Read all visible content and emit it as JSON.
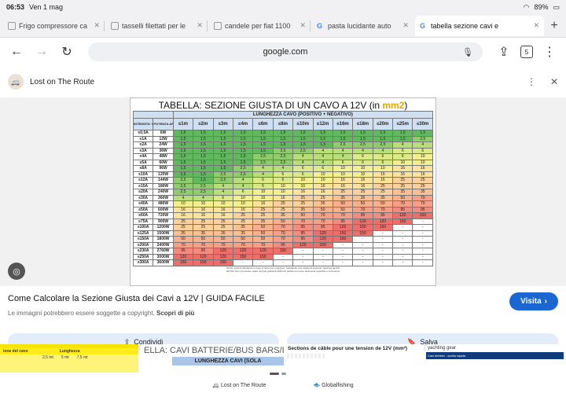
{
  "status": {
    "time": "06:53",
    "date": "Ven 1 mag",
    "battery": "89%"
  },
  "tabs": [
    {
      "title": "Frigo compressore cа"
    },
    {
      "title": "tasselli filettati per le"
    },
    {
      "title": "candele per fiat 1100"
    },
    {
      "title": "pasta lucidante auto"
    },
    {
      "title": "tabella sezione cavi e"
    }
  ],
  "toolbar": {
    "url": "google.com",
    "tab_count": "5"
  },
  "site": {
    "name": "Lost on The Route"
  },
  "table": {
    "title": "TABELLA: SEZIONE GIUSTA DI UN CAVO A 12V (in ",
    "title_unit": "mm2",
    "title_end": ")",
    "length_header": "LUNGHEZZA CAVO (POSITIVO + NEGATIVO)",
    "col1_header": "INTENSITA' CORRENTE",
    "col2_header": "POTENZA APPARATO",
    "lengths": [
      "≤1m",
      "≤2m",
      "≤3m",
      "≤4m",
      "≤6m",
      "≤8m",
      "≤10m",
      "≤12m",
      "≤16m",
      "≤18m",
      "≤20m",
      "≤25m",
      "≤30m"
    ],
    "rows": [
      [
        "≤0,5A",
        "6W",
        "1,5",
        "1,5",
        "1,5",
        "1,5",
        "1,5",
        "1,5",
        "1,5",
        "1,5",
        "1,5",
        "1,5",
        "1,5",
        "1,5",
        "1,5"
      ],
      [
        "≤1A",
        "12W",
        "1,5",
        "1,5",
        "1,5",
        "1,5",
        "1,5",
        "1,5",
        "1,5",
        "1,5",
        "1,5",
        "1,5",
        "1,5",
        "1,5",
        "2,5"
      ],
      [
        "≤2A",
        "24W",
        "1,5",
        "1,5",
        "1,5",
        "1,5",
        "1,5",
        "1,5",
        "1,5",
        "1,5",
        "2,5",
        "2,5",
        "2,5",
        "4",
        "4"
      ],
      [
        "≤3A",
        "36W",
        "1,5",
        "1,5",
        "1,5",
        "1,5",
        "1,5",
        "2,5",
        "2,5",
        "4",
        "4",
        "4",
        "4",
        "6",
        "6"
      ],
      [
        "≤4A",
        "48W",
        "1,5",
        "1,5",
        "1,5",
        "1,5",
        "2,5",
        "2,5",
        "4",
        "4",
        "4",
        "6",
        "6",
        "6",
        "10"
      ],
      [
        "≤5A",
        "60W",
        "1,5",
        "1,5",
        "1,5",
        "1,5",
        "2,5",
        "2,5",
        "4",
        "4",
        "6",
        "6",
        "6",
        "10",
        "10"
      ],
      [
        "≤8A",
        "96W",
        "1,5",
        "1,5",
        "1,5",
        "2,5",
        "4",
        "4",
        "6",
        "6",
        "10",
        "10",
        "10",
        "16",
        "16"
      ],
      [
        "≤10A",
        "120W",
        "1,5",
        "1,5",
        "2,5",
        "2,5",
        "4",
        "6",
        "6",
        "10",
        "10",
        "10",
        "16",
        "16",
        "16"
      ],
      [
        "≤12A",
        "144W",
        "2,5",
        "1,5",
        "2,5",
        "4",
        "6",
        "6",
        "10",
        "10",
        "16",
        "16",
        "16",
        "25",
        "25"
      ],
      [
        "≤15A",
        "180W",
        "2,5",
        "2,5",
        "4",
        "4",
        "6",
        "10",
        "10",
        "16",
        "16",
        "16",
        "25",
        "25",
        "25"
      ],
      [
        "≤20A",
        "240W",
        "2,5",
        "2,5",
        "4",
        "6",
        "10",
        "10",
        "16",
        "16",
        "25",
        "25",
        "25",
        "35",
        "35"
      ],
      [
        "≤30A",
        "360W",
        "4",
        "4",
        "6",
        "10",
        "10",
        "16",
        "25",
        "25",
        "35",
        "35",
        "35",
        "50",
        "70"
      ],
      [
        "≤40A",
        "480W",
        "10",
        "10",
        "10",
        "10",
        "16",
        "25",
        "25",
        "35",
        "50",
        "50",
        "50",
        "70",
        "70"
      ],
      [
        "≤50A",
        "600W",
        "16",
        "16",
        "16",
        "16",
        "25",
        "25",
        "35",
        "50",
        "50",
        "70",
        "70",
        "95",
        "95"
      ],
      [
        "≤60A",
        "720W",
        "16",
        "16",
        "16",
        "25",
        "25",
        "35",
        "50",
        "70",
        "70",
        "95",
        "95",
        "120",
        "150"
      ],
      [
        "≤75A",
        "900W",
        "25",
        "25",
        "25",
        "25",
        "35",
        "50",
        "70",
        "70",
        "95",
        "120",
        "120",
        "150",
        "-"
      ],
      [
        "≤100A",
        "1200W",
        "25",
        "25",
        "25",
        "35",
        "50",
        "70",
        "95",
        "95",
        "120",
        "150",
        "150",
        "-",
        "-"
      ],
      [
        "≤125A",
        "1500W",
        "35",
        "35",
        "35",
        "35",
        "50",
        "70",
        "95",
        "120",
        "150",
        "150",
        "-",
        "-",
        "-"
      ],
      [
        "≤150A",
        "1800W",
        "50",
        "50",
        "50",
        "50",
        "50",
        "70",
        "95",
        "120",
        "150",
        "-",
        "-",
        "-",
        "-"
      ],
      [
        "≤200A",
        "2400W",
        "70",
        "70",
        "70",
        "70",
        "70",
        "95",
        "120",
        "150",
        "-",
        "-",
        "-",
        "-",
        "-"
      ],
      [
        "≤230A",
        "2760W",
        "95",
        "95",
        "120",
        "120",
        "120",
        "150",
        "-",
        "-",
        "-",
        "-",
        "-",
        "-",
        "-"
      ],
      [
        "≤250A",
        "3000W",
        "120",
        "120",
        "120",
        "150",
        "150",
        "-",
        "-",
        "-",
        "-",
        "-",
        "-",
        "-",
        "-"
      ],
      [
        "≤300A",
        "3600W",
        "150",
        "150",
        "150",
        "-",
        "-",
        "-",
        "-",
        "-",
        "-",
        "-",
        "-",
        "-",
        "-"
      ]
    ],
    "note1": "NOTA: sezioni ottimali di un cavo in rame (con margine), calcolando una caduta di tensione massima del 3%",
    "note2": "NOTA2: Non si possono usare cavi più grandi di 150mm2 poiché non sono facilmente reperibili in commercio"
  },
  "caption": {
    "title": "Come Calcolare la Sezione Giusta dei Cavi a 12V | GUIDA FACILE",
    "sub": "Le immagini potrebbero essere soggette a copyright. ",
    "more": "Scopri di più",
    "visit": "Visita"
  },
  "actions": {
    "share": "Condividi",
    "save": "Salva"
  },
  "thumbs": {
    "t1": {
      "hdr1": "ione del cavo",
      "hdr2": "Lunghezza",
      "c1": "2,5 mt",
      "c2": "5 mt",
      "c3": "7,5 mt"
    },
    "t2": {
      "title": "ELLA: CAVI BATTERIE/BUS BARS/INV",
      "label": "LUNGHEZZA CAVI (SOLA"
    },
    "t3": {
      "title": "Sections de câble pour une tension de 12V (mm²)"
    },
    "t4": {
      "logo": "yachting gear",
      "bar": "Cavi elettrici - scelta rapida"
    }
  },
  "bottom": {
    "left": "Lost on The Route",
    "right": "Globalfishing"
  }
}
